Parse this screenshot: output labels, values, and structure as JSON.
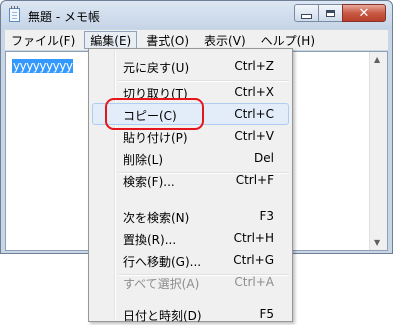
{
  "window": {
    "title": "無題 - メモ帳",
    "caption_buttons": {
      "minimize": "minimize",
      "maximize": "maximize",
      "close": "✕"
    }
  },
  "menubar": [
    "ファイル(F)",
    "編集(E)",
    "書式(O)",
    "表示(V)",
    "ヘルプ(H)"
  ],
  "editor": {
    "selected_text": "yyyyyyyyy"
  },
  "edit_menu": [
    {
      "label": "元に戻す(U)",
      "shortcut": "Ctrl+Z",
      "disabled": false
    },
    {
      "separator": true
    },
    {
      "label": "切り取り(T)",
      "shortcut": "Ctrl+X",
      "disabled": false
    },
    {
      "label": "コピー(C)",
      "shortcut": "Ctrl+C",
      "disabled": false,
      "hover": true
    },
    {
      "label": "貼り付け(P)",
      "shortcut": "Ctrl+V",
      "disabled": false
    },
    {
      "label": "削除(L)",
      "shortcut": "Del",
      "disabled": false
    },
    {
      "separator": true
    },
    {
      "label": "検索(F)...",
      "shortcut": "Ctrl+F",
      "disabled": false
    },
    {
      "label": "次を検索(N)",
      "shortcut": "F3",
      "disabled": false
    },
    {
      "label": "置換(R)...",
      "shortcut": "Ctrl+H",
      "disabled": false
    },
    {
      "label": "行へ移動(G)...",
      "shortcut": "Ctrl+G",
      "disabled": false
    },
    {
      "separator": true
    },
    {
      "label": "すべて選択(A)",
      "shortcut": "Ctrl+A",
      "disabled": true
    },
    {
      "label": "日付と時刻(D)",
      "shortcut": "F5",
      "disabled": false
    }
  ],
  "colors": {
    "annotation_ring": "#e5161b",
    "selection": "#3399ff"
  }
}
